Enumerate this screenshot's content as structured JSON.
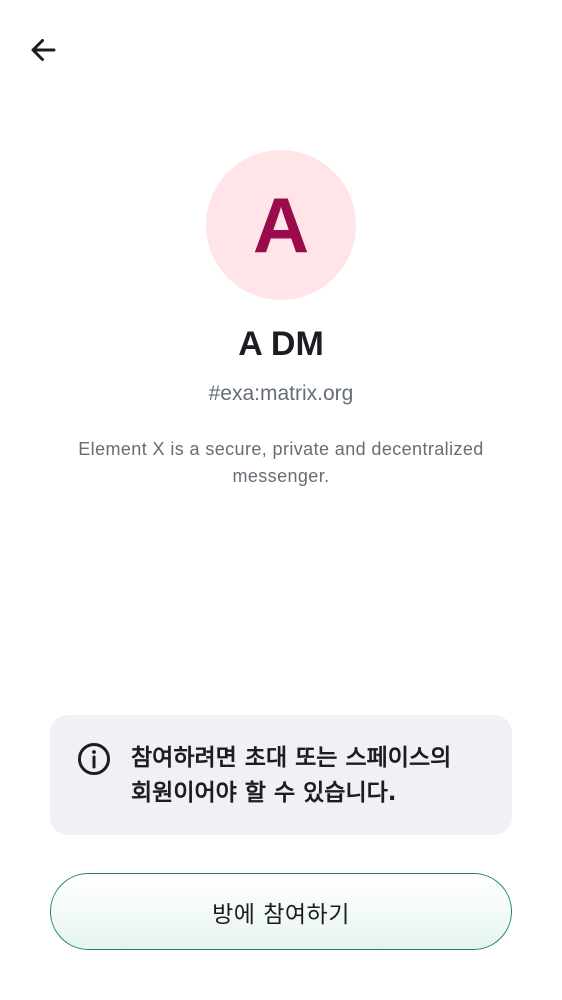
{
  "header": {
    "back_icon": "arrow-left-icon"
  },
  "room": {
    "avatar_letter": "A",
    "avatar_bg_color": "#ffe4e8",
    "avatar_fg_color": "#9b0a4b",
    "name": "A DM",
    "alias": "#exa:matrix.org",
    "topic": "Element X is a secure, private and decentralized messenger."
  },
  "info": {
    "icon": "info-circle-icon",
    "text": "참여하려면 초대 또는 스페이스의 회원이어야 할 수 있습니다."
  },
  "actions": {
    "join_label": "방에 참여하기",
    "accent_color": "#1a8a5e"
  }
}
